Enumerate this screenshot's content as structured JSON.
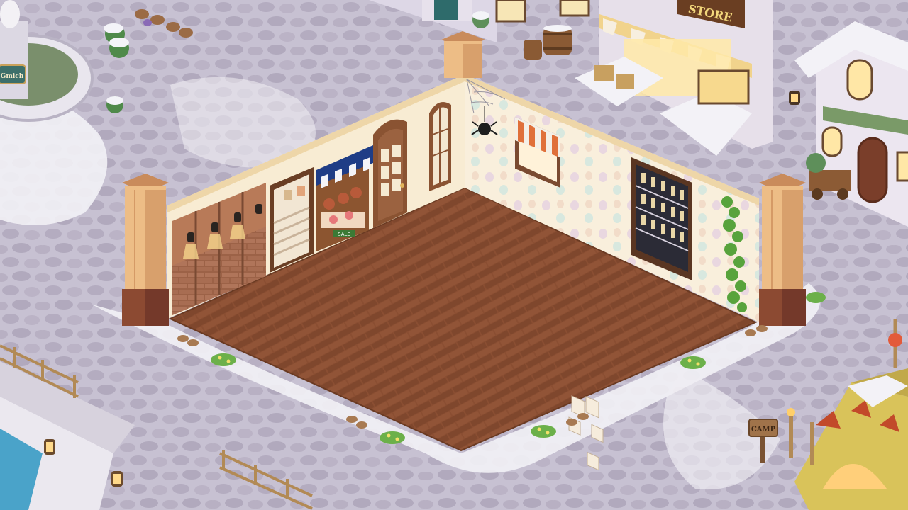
{
  "scene": {
    "store_sign": "STORE",
    "camp_sign": "CAMP",
    "fountain_plaque": "Gmich",
    "meat_stall_banner": "SALE"
  },
  "colors": {
    "floor": "#8a4e32",
    "floor_dark": "#6e3b24",
    "wall": "#f7ead0",
    "pillar": "#e8b57c",
    "snow": "#f2f1f6",
    "cobble": "#bdb6c8"
  }
}
